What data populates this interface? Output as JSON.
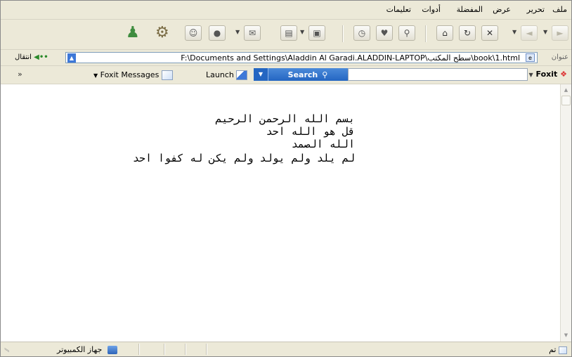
{
  "menubar": {
    "items": [
      {
        "name": "menu-file",
        "label": "ملف"
      },
      {
        "name": "menu-edit",
        "label": "تحرير"
      },
      {
        "name": "menu-view",
        "label": "عرض"
      },
      {
        "name": "menu-favorites",
        "label": "المفضلة"
      },
      {
        "name": "menu-tools",
        "label": "أدوات"
      },
      {
        "name": "menu-help",
        "label": "تعليمات"
      }
    ]
  },
  "toolbar": {
    "icons": [
      "back-icon",
      "forward-icon",
      "stop-icon",
      "refresh-icon",
      "home-icon",
      "search-icon",
      "favorites-icon",
      "history-icon",
      "media-icon",
      "print-icon",
      "mail-icon",
      "discuss-icon",
      "messenger-icon",
      "users-icon"
    ]
  },
  "address": {
    "label": "عنوان",
    "url": "F:\\Documents and Settings\\Aladdin Al Garadi.ALADDIN-LAPTOP\\سطح المكتب\\book\\1.html",
    "go_label": "انتقال"
  },
  "foxit": {
    "logo": "Foxit",
    "search_label": "Search",
    "launch_label": "Launch",
    "messages_label": "Foxit Messages"
  },
  "document": {
    "lines": [
      "بسم الله الرحمن الرحيم",
      "قل هو الله احد",
      "الله الصمد",
      "لم يلد ولم يولد ولم يكن له كفوا احد"
    ]
  },
  "status": {
    "done": "تم",
    "zone": "جهاز الكمبيوتر"
  }
}
